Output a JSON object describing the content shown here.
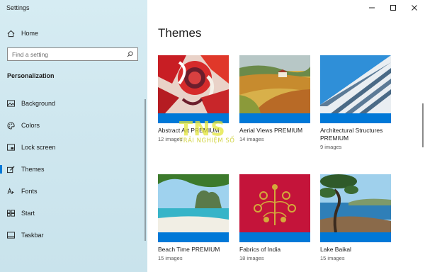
{
  "window": {
    "title": "Settings"
  },
  "sidebar": {
    "home_label": "Home",
    "search_placeholder": "Find a setting",
    "section_title": "Personalization",
    "items": [
      {
        "label": "Background",
        "icon": "picture-icon"
      },
      {
        "label": "Colors",
        "icon": "palette-icon"
      },
      {
        "label": "Lock screen",
        "icon": "lock-screen-icon"
      },
      {
        "label": "Themes",
        "icon": "brush-icon",
        "active": true
      },
      {
        "label": "Fonts",
        "icon": "font-icon"
      },
      {
        "label": "Start",
        "icon": "start-icon"
      },
      {
        "label": "Taskbar",
        "icon": "taskbar-icon"
      }
    ]
  },
  "main": {
    "title": "Themes",
    "themes": [
      {
        "name": "Abstract Art PREMIUM",
        "count": "12 images"
      },
      {
        "name": "Aerial Views PREMIUM",
        "count": "14 images"
      },
      {
        "name": "Architectural Structures PREMIUM",
        "count": "9 images"
      },
      {
        "name": "Beach Time PREMIUM",
        "count": "15 images"
      },
      {
        "name": "Fabrics of India",
        "count": "18 images"
      },
      {
        "name": "Lake Baikal",
        "count": "15 images"
      }
    ]
  },
  "watermark": {
    "logo": "TNS",
    "text": "TRẢI NGHIỆM SỐ"
  },
  "colors": {
    "accent": "#0078d7",
    "sidebar_bg": "#d6ecf3"
  }
}
